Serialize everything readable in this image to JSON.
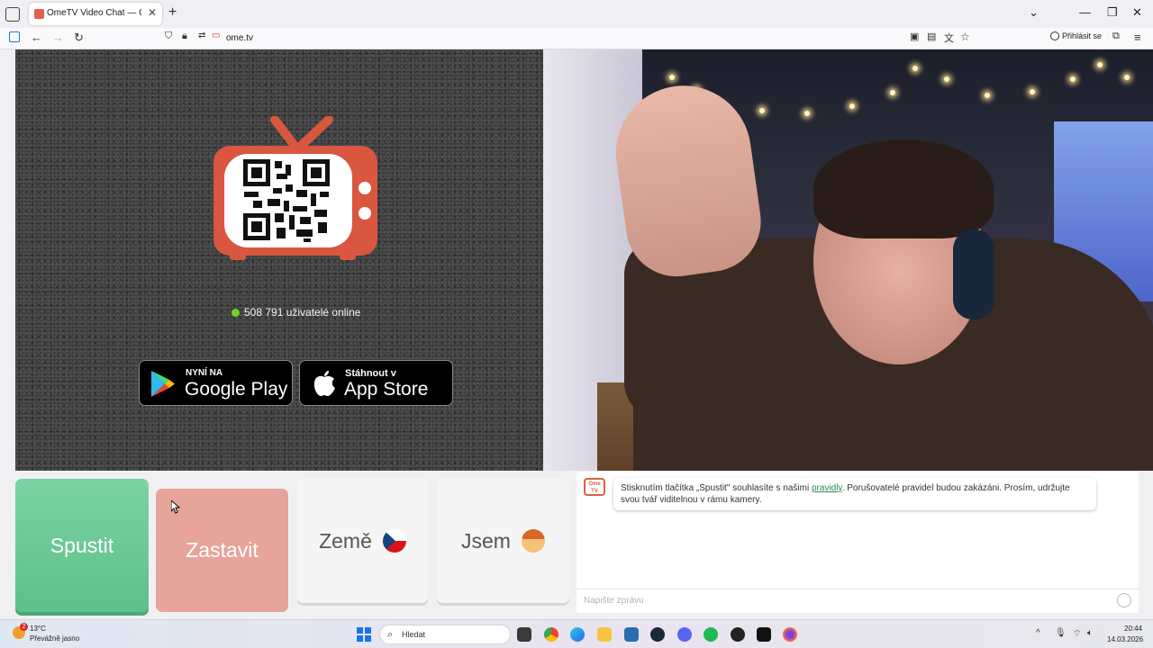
{
  "browser": {
    "tab_title": "OmeTV Video Chat — Omegle",
    "url": "ome.tv",
    "signin_label": "Přihlásit se"
  },
  "left_panel": {
    "online_count": "508 791 uživatelé online",
    "google_play": {
      "small": "NYNÍ NA",
      "big": "Google Play"
    },
    "app_store": {
      "small": "Stáhnout v",
      "big": "App Store"
    }
  },
  "controls": {
    "start_label": "Spustit",
    "stop_label": "Zastavit",
    "country_label": "Země",
    "gender_label": "Jsem"
  },
  "chat": {
    "logo_text": "Ome TV",
    "message_before": "Stisknutím tlačítka „Spustit\" souhlasíte s našimi ",
    "message_link": "pravidly",
    "message_after": ". Porušovatelé pravidel budou zakázáni. Prosím, udržujte svou tvář viditelnou v rámu kamery.",
    "placeholder": "Napište zprávu"
  },
  "taskbar": {
    "weather_temp": "13°C",
    "weather_desc": "Převážně jasno",
    "weather_badge": "2",
    "search_label": "Hledat",
    "time": "20:44",
    "date": "14.03.2026"
  },
  "colors": {
    "start_green": "#6cc896",
    "stop_salmon": "#e6a49a",
    "online_green": "#6ed324",
    "link_green": "#2a8a55"
  }
}
